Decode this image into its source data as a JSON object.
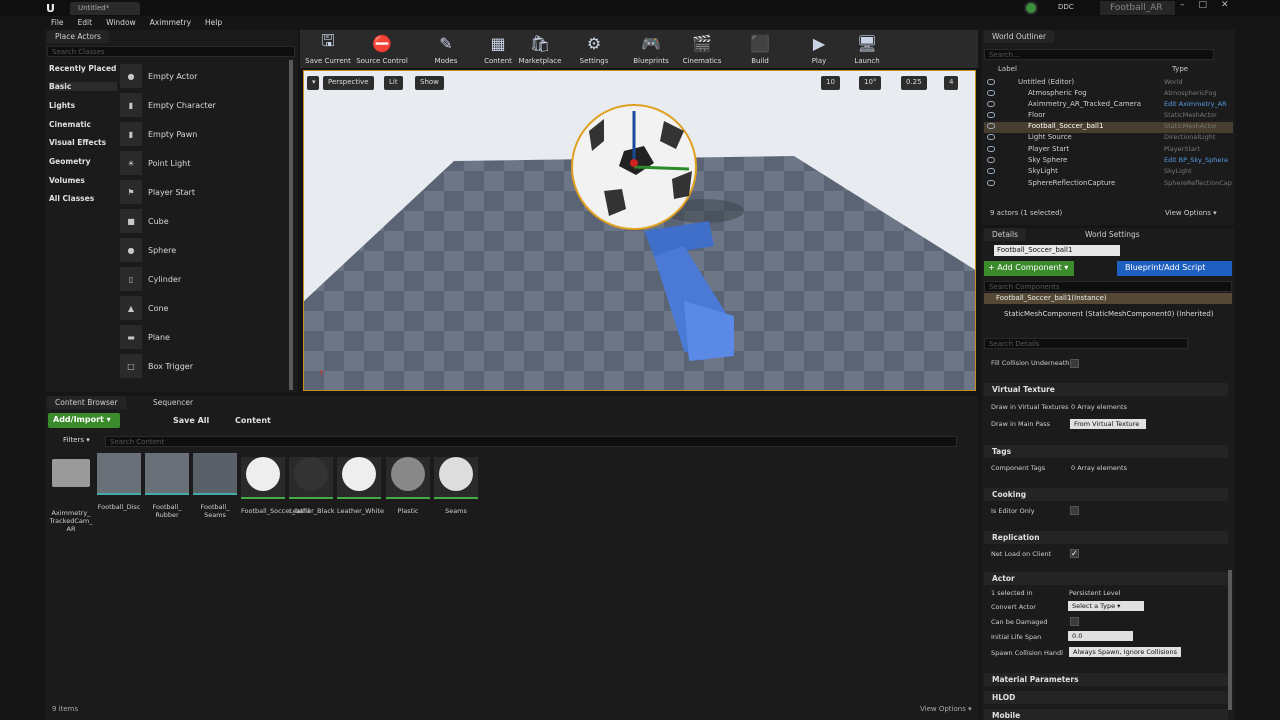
{
  "titlebar": {
    "logo": "U",
    "doc_tab": "Untitled*",
    "ddc": "DDC",
    "project_tab": "Football_AR",
    "win_min": "–",
    "win_max": "□",
    "win_close": "✕"
  },
  "menu": [
    "File",
    "Edit",
    "Window",
    "Aximmetry",
    "Help"
  ],
  "place_actors": {
    "tab": "Place Actors",
    "search_placeholder": "Search Classes",
    "categories": [
      "Recently Placed",
      "Basic",
      "Lights",
      "Cinematic",
      "Visual Effects",
      "Geometry",
      "Volumes",
      "All Classes"
    ],
    "selected_category": "Basic",
    "actors": [
      "Empty Actor",
      "Empty Character",
      "Empty Pawn",
      "Point Light",
      "Player Start",
      "Cube",
      "Sphere",
      "Cylinder",
      "Cone",
      "Plane",
      "Box Trigger"
    ]
  },
  "toolbar": [
    "Save Current",
    "Source Control",
    "Modes",
    "Content",
    "Marketplace",
    "Settings",
    "Blueprints",
    "Cinematics",
    "Build",
    "Play",
    "Launch"
  ],
  "viewport": {
    "perspective": "Perspective",
    "lit": "Lit",
    "show": "Show",
    "grid": "10",
    "angle": "10°",
    "scale": "0.25",
    "speed": "4"
  },
  "content_browser": {
    "tab1": "Content Browser",
    "tab2": "Sequencer",
    "add_import": "Add/Import ▾",
    "save_all": "Save All",
    "path": "Content",
    "filters": "Filters ▾",
    "search_placeholder": "Search Content",
    "assets": [
      "Aximmetry_ TrackedCam_ AR",
      "Football_Disc",
      "Football_ Rubber",
      "Football_ Seams",
      "Football_Soccer_ball1",
      "Leather_Black",
      "Leather_White",
      "Plastic",
      "Seams"
    ],
    "items_count": "9 items",
    "view_options": "View Options ▾"
  },
  "outliner": {
    "tab": "World Outliner",
    "search_placeholder": "Search...",
    "col_label": "Label",
    "col_type": "Type",
    "rows": [
      {
        "label": "Untitled (Editor)",
        "type": "World"
      },
      {
        "label": "Atmospheric Fog",
        "type": "AtmosphericFog"
      },
      {
        "label": "Aximmetry_AR_Tracked_Camera",
        "type": "Edit Aximmetry_AR"
      },
      {
        "label": "Floor",
        "type": "StaticMeshActor"
      },
      {
        "label": "Football_Soccer_ball1",
        "type": "StaticMeshActor"
      },
      {
        "label": "Light Source",
        "type": "DirectionalLight"
      },
      {
        "label": "Player Start",
        "type": "PlayerStart"
      },
      {
        "label": "Sky Sphere",
        "type": "Edit BP_Sky_Sphere"
      },
      {
        "label": "SkyLight",
        "type": "SkyLight"
      },
      {
        "label": "SphereReflectionCapture",
        "type": "SphereReflectionCap"
      }
    ],
    "footer": "9 actors (1 selected)",
    "view_options": "View Options ▾"
  },
  "details": {
    "tab": "Details",
    "tab2": "World Settings",
    "name_field": "Football_Soccer_ball1",
    "add_component": "+ Add Component ▾",
    "blueprint": "Blueprint/Add Script",
    "search_components": "Search Components",
    "instance": "Football_Soccer_ball1(Instance)",
    "component": "StaticMeshComponent (StaticMeshComponent0) (Inherited)",
    "search_details": "Search Details",
    "fill_collision": "Fill Collision Underneath",
    "sections": {
      "virtual_texture": "Virtual Texture",
      "tags": "Tags",
      "cooking": "Cooking",
      "replication": "Replication",
      "actor": "Actor",
      "material_params": "Material Parameters",
      "hlod": "HLOD",
      "mobile": "Mobile"
    },
    "draw_in_vt": "Draw in Virtual Textures",
    "array_elements": "0 Array elements",
    "draw_main_pass": "Draw in Main Pass",
    "draw_main_pass_val": "From Virtual Texture ▾",
    "component_tags": "Component Tags",
    "tags_val": "0 Array elements",
    "editor_only": "Is Editor Only",
    "net_load": "Net Load on Client",
    "selected_in": "1 selected in",
    "selected_in_val": "Persistent Level",
    "convert_actor": "Convert Actor",
    "convert_val": "Select a Type ▾",
    "can_damage": "Can be Damaged",
    "life_span": "Initial Life Span",
    "life_val": "0.0",
    "spawn_coll": "Spawn Collision Handl",
    "spawn_val": "Always Spawn, Ignore Collisions ▾"
  }
}
